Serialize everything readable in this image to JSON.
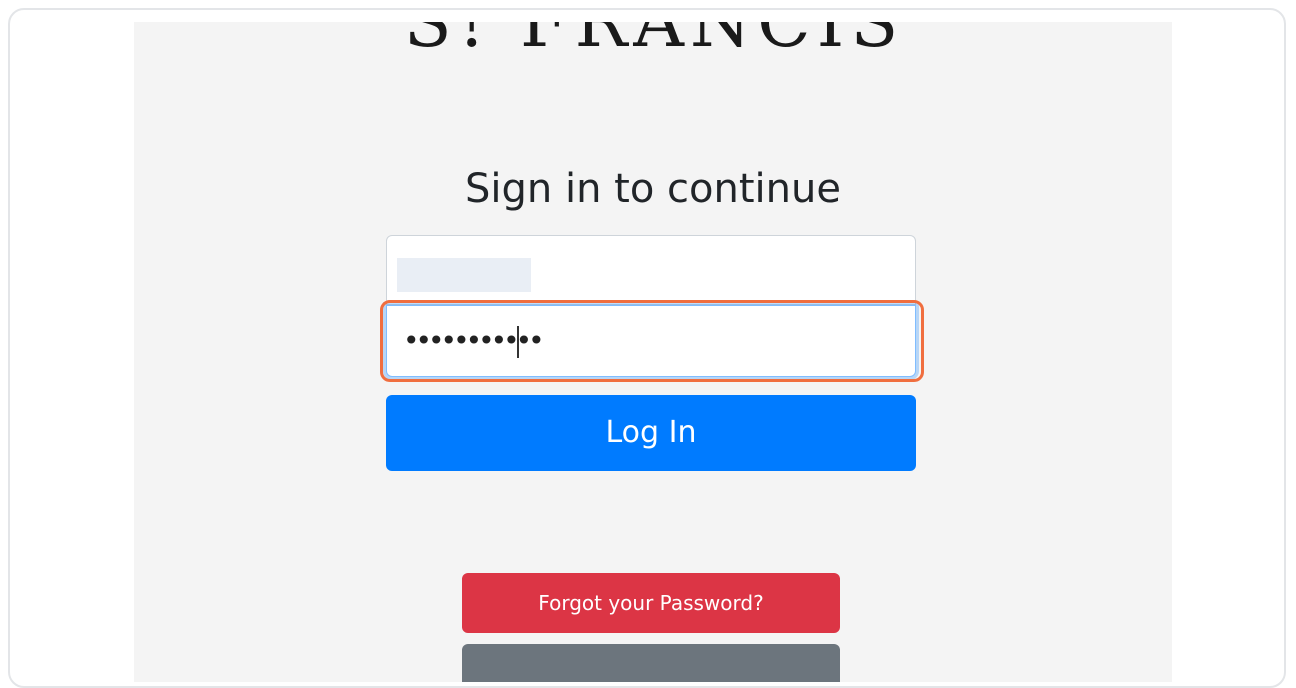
{
  "logo": {
    "text": "S! FRANCIS"
  },
  "login": {
    "heading": "Sign in to continue",
    "username": {
      "value": ""
    },
    "password": {
      "value": "•••••••••••"
    },
    "login_button": "Log In",
    "forgot_button": "Forgot your Password?"
  },
  "colors": {
    "primary": "#007bff",
    "danger": "#dc3545",
    "secondary": "#6c757d",
    "highlight": "#f06e3f",
    "page_bg": "#f4f4f4"
  }
}
